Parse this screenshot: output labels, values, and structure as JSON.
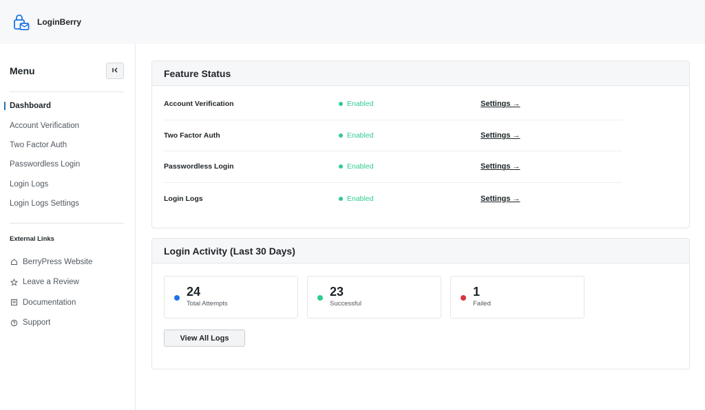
{
  "app": {
    "brand": "LoginBerry"
  },
  "sidebar": {
    "title": "Menu",
    "items": [
      {
        "label": "Dashboard",
        "active": true
      },
      {
        "label": "Account Verification"
      },
      {
        "label": "Two Factor Auth"
      },
      {
        "label": "Passwordless Login"
      },
      {
        "label": "Login Logs"
      },
      {
        "label": "Login Logs Settings"
      }
    ],
    "external_heading": "External Links",
    "external": [
      {
        "label": "BerryPress Website",
        "icon": "home-icon"
      },
      {
        "label": "Leave a Review",
        "icon": "star-icon"
      },
      {
        "label": "Documentation",
        "icon": "book-icon"
      },
      {
        "label": "Support",
        "icon": "help-circle-icon"
      }
    ]
  },
  "features": {
    "title": "Feature Status",
    "rows": [
      {
        "name": "Account Verification",
        "status": "Enabled",
        "link": "Settings →"
      },
      {
        "name": "Two Factor Auth",
        "status": "Enabled",
        "link": "Settings →"
      },
      {
        "name": "Passwordless Login",
        "status": "Enabled",
        "link": "Settings →"
      },
      {
        "name": "Login Logs",
        "status": "Enabled",
        "link": "Settings →"
      }
    ]
  },
  "activity": {
    "title": "Login Activity (Last 30 Days)",
    "stats": [
      {
        "value": "24",
        "label": "Total Attempts",
        "color": "#1a73e8"
      },
      {
        "value": "23",
        "label": "Successful",
        "color": "#2ecc8f"
      },
      {
        "value": "1",
        "label": "Failed",
        "color": "#d63638"
      }
    ],
    "button": "View All Logs"
  },
  "colors": {
    "accent": "#2271b1",
    "enabled": "#2ecc8f"
  }
}
